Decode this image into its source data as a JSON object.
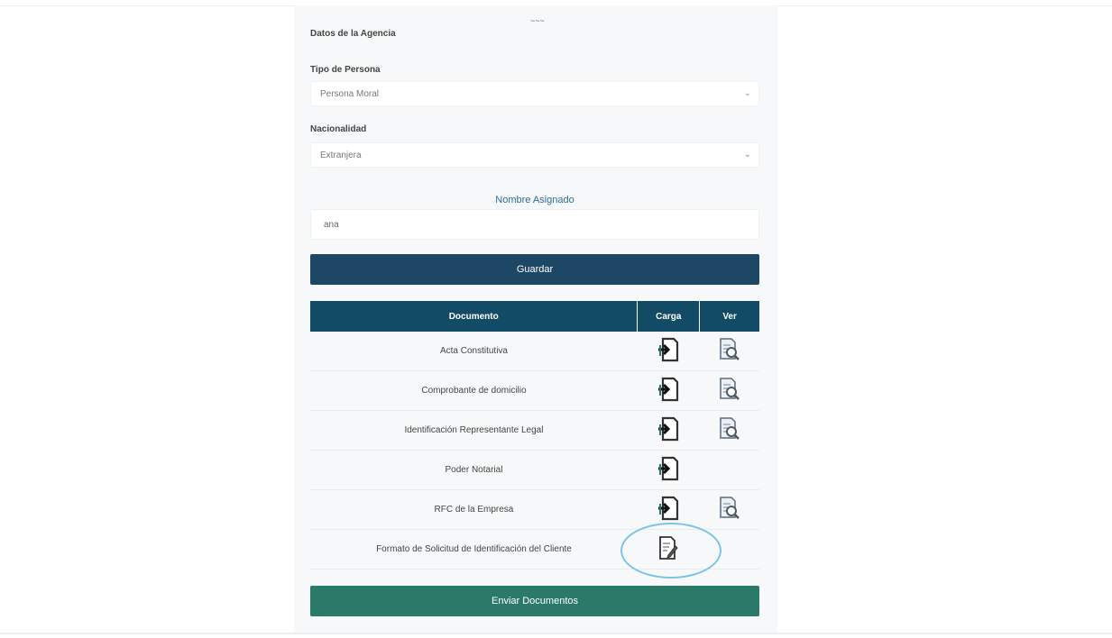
{
  "page": {
    "top_mark": "~~~"
  },
  "form": {
    "section_title": "Datos de la Agencia",
    "person_type": {
      "label": "Tipo de Persona",
      "value": "Persona Moral"
    },
    "nationality": {
      "label": "Nacionalidad",
      "value": "Extranjera"
    },
    "name": {
      "label": "Nombre Asignado",
      "value": "ana"
    },
    "save_label": "Guardar"
  },
  "table": {
    "headers": {
      "document": "Documento",
      "upload": "Carga",
      "view": "Ver"
    },
    "rows": [
      {
        "document": "Acta Constitutiva",
        "upload_icon": "upload-doc-icon",
        "view_icon": "view-doc-icon",
        "has_view": true
      },
      {
        "document": "Comprobante de domicilio",
        "upload_icon": "upload-doc-icon",
        "view_icon": "view-doc-icon",
        "has_view": true
      },
      {
        "document": "Identificación Representante Legal",
        "upload_icon": "upload-doc-icon",
        "view_icon": "view-doc-icon",
        "has_view": true
      },
      {
        "document": "Poder Notarial",
        "upload_icon": "upload-doc-icon",
        "view_icon": "",
        "has_view": false
      },
      {
        "document": "RFC de la Empresa",
        "upload_icon": "upload-doc-icon",
        "view_icon": "view-doc-icon",
        "has_view": true
      },
      {
        "document": "Formato de Solicitud de Identificación del Cliente",
        "upload_icon": "edit-form-icon",
        "view_icon": "",
        "has_view": false
      }
    ]
  },
  "footer": {
    "submit_label": "Enviar Documentos"
  },
  "colors": {
    "primary": "#1e4766",
    "table_header": "#124b66",
    "success": "#2b7a69",
    "accent_label": "#2c6d9a",
    "highlight": "#7cc3e6"
  }
}
